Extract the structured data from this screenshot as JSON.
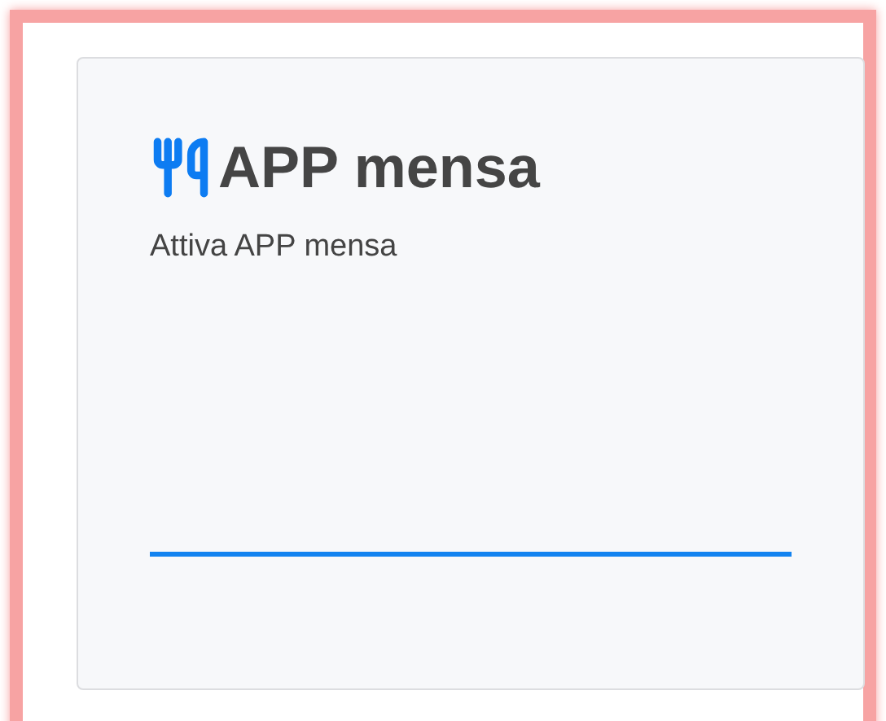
{
  "card": {
    "title": "APP mensa",
    "description": "Attiva APP mensa"
  }
}
